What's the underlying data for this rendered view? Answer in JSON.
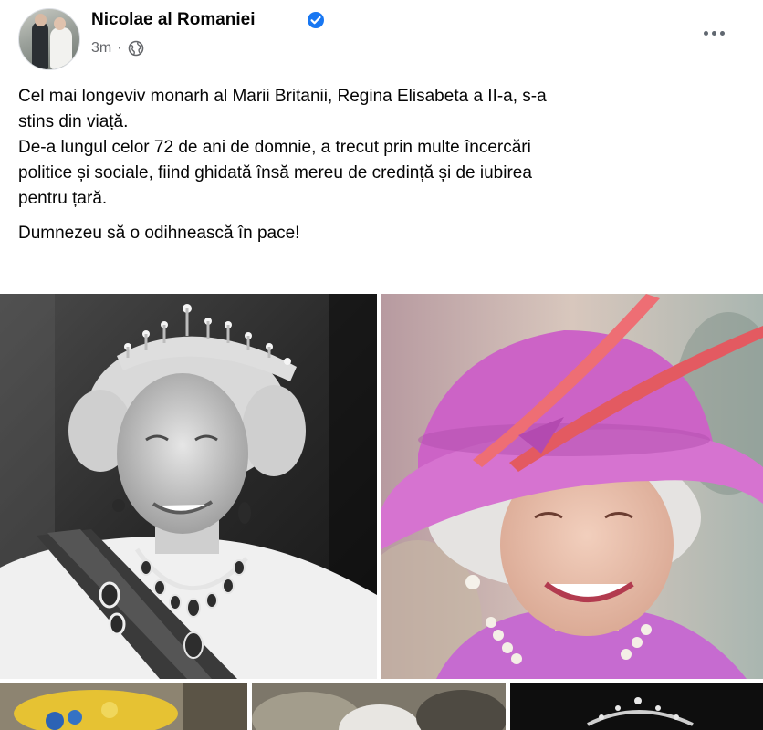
{
  "post": {
    "author": "Nicolae al Romaniei",
    "verified": true,
    "timestamp": "3m",
    "separator": "·",
    "audience_icon": "globe-icon",
    "more_icon": "more-options-icon",
    "text": {
      "line1": "Cel mai longeviv monarh al Marii Britanii, Regina Elisabeta a II-a, s-a",
      "line2": "stins din viață.",
      "line3": "De-a lungul celor 72 de ani de domnie, a trecut prin multe încercări",
      "line4": "politice și sociale, fiind ghidată însă mereu de credință și de iubirea",
      "line5": "pentru țară.",
      "line6": "Dumnezeu să o odihnească în pace!"
    }
  },
  "colors": {
    "verified_badge": "#1877f2",
    "secondary_text": "#65676b",
    "primary_text": "#050505",
    "hat_pink": "#c95fc3",
    "feather": "#e8686a"
  },
  "photos": [
    {
      "name": "queen-bw-portrait-tiara"
    },
    {
      "name": "queen-pink-hat-portrait"
    },
    {
      "name": "queen-yellow-hat-photo"
    },
    {
      "name": "queen-crowd-photo"
    },
    {
      "name": "queen-tiara-dark-photo"
    }
  ]
}
